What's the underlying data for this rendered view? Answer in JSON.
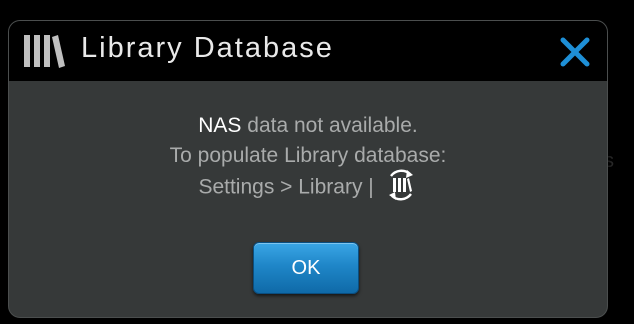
{
  "dialog": {
    "title": "Library Database",
    "icons": {
      "library": "library-books-icon",
      "close": "close-icon",
      "sync": "library-sync-icon"
    },
    "message": {
      "line1_strong": "NAS",
      "line1_rest": " data not available.",
      "line2": "To populate Library database:",
      "line3": "Settings > Library | "
    },
    "ok_label": "OK"
  },
  "colors": {
    "titlebar": "#000000",
    "body": "#363939",
    "accent": "#1f86c8",
    "close": "#1e8fd6",
    "text_primary": "#ffffff",
    "text_secondary": "#a9abab"
  },
  "background_glyph": "s"
}
